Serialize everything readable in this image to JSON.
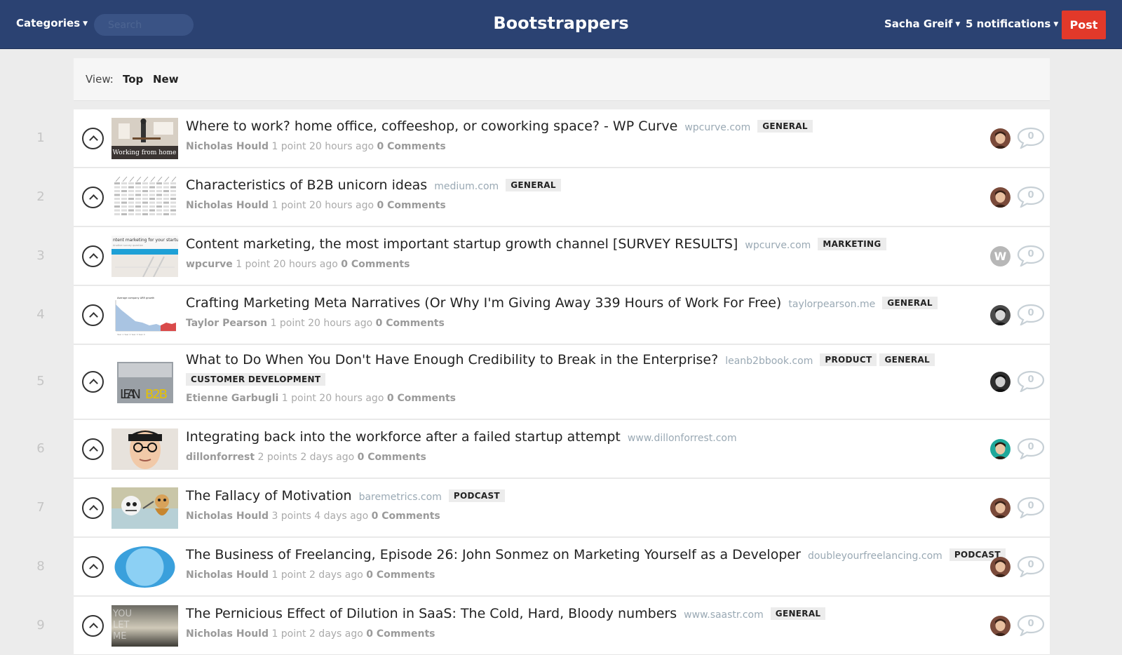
{
  "header": {
    "categories": "Categories",
    "search_placeholder": "Search",
    "site_title": "Bootstrappers",
    "user": "Sacha Greif",
    "notifications": "5 notifications",
    "post_button": "Post",
    "colors": {
      "bar": "#2b4272",
      "post_button": "#e2392a"
    }
  },
  "view_bar": {
    "label": "View:",
    "options": [
      "Top",
      "New"
    ]
  },
  "posts": [
    {
      "rank": "1",
      "title": "Where to work? home office, coffeeshop, or coworking space? - WP Curve",
      "domain": "wpcurve.com",
      "tags": [
        "GENERAL"
      ],
      "author": "Nicholas Hould",
      "points": "1 point",
      "time": "20 hours ago",
      "comments": "0 Comments",
      "comment_count": "0",
      "thumb_text": "Working from home",
      "avatar": "portrait-1"
    },
    {
      "rank": "2",
      "title": "Characteristics of B2B unicorn ideas",
      "domain": "medium.com",
      "tags": [
        "GENERAL"
      ],
      "author": "Nicholas Hould",
      "points": "1 point",
      "time": "20 hours ago",
      "comments": "0 Comments",
      "comment_count": "0",
      "avatar": "portrait-1"
    },
    {
      "rank": "3",
      "title": "Content marketing, the most important startup growth channel [SURVEY RESULTS]",
      "domain": "wpcurve.com",
      "tags": [
        "MARKETING"
      ],
      "author": "wpcurve",
      "points": "1 point",
      "time": "20 hours ago",
      "comments": "0 Comments",
      "comment_count": "0",
      "thumb_text": "ntent marketing for your startup?",
      "avatar_initial": "W"
    },
    {
      "rank": "4",
      "title": "Crafting Marketing Meta Narratives (Or Why I'm Giving Away 339 Hours of Work For Free)",
      "domain": "taylorpearson.me",
      "tags": [
        "GENERAL"
      ],
      "author": "Taylor Pearson",
      "points": "1 point",
      "time": "20 hours ago",
      "comments": "0 Comments",
      "comment_count": "0",
      "avatar": "portrait-2"
    },
    {
      "rank": "5",
      "title": "What to Do When You Don't Have Enough Credibility to Break in the Enterprise?",
      "domain": "leanb2bbook.com",
      "tags": [
        "PRODUCT",
        "GENERAL"
      ],
      "tags_line2": [
        "CUSTOMER DEVELOPMENT"
      ],
      "author": "Etienne Garbugli",
      "points": "1 point",
      "time": "20 hours ago",
      "comments": "0 Comments",
      "comment_count": "0",
      "thumb_text": "LEAN B2B",
      "avatar": "portrait-3"
    },
    {
      "rank": "6",
      "title": "Integrating back into the workforce after a failed startup attempt",
      "domain": "www.dillonforrest.com",
      "tags": [],
      "author": "dillonforrest",
      "points": "2 points",
      "time": "2 days ago",
      "comments": "0 Comments",
      "comment_count": "0",
      "avatar": "portrait-4"
    },
    {
      "rank": "7",
      "title": "The Fallacy of Motivation",
      "domain": "baremetrics.com",
      "tags": [
        "PODCAST"
      ],
      "author": "Nicholas Hould",
      "points": "3 points",
      "time": "4 days ago",
      "comments": "0 Comments",
      "comment_count": "0",
      "avatar": "portrait-1"
    },
    {
      "rank": "8",
      "title": "The Business of Freelancing, Episode 26: John Sonmez on Marketing Yourself as a Developer",
      "domain": "doubleyourfreelancing.com",
      "tags": [
        "PODCAST"
      ],
      "author": "Nicholas Hould",
      "points": "1 point",
      "time": "2 days ago",
      "comments": "0 Comments",
      "comment_count": "0",
      "avatar": "portrait-1"
    },
    {
      "rank": "9",
      "title": "The Pernicious Effect of Dilution in SaaS: The Cold, Hard, Bloody numbers",
      "domain": "www.saastr.com",
      "tags": [
        "GENERAL"
      ],
      "author": "Nicholas Hould",
      "points": "1 point",
      "time": "2 days ago",
      "comments": "0 Comments",
      "comment_count": "0",
      "thumb_text": "YOU LET ME",
      "avatar": "portrait-1"
    }
  ]
}
